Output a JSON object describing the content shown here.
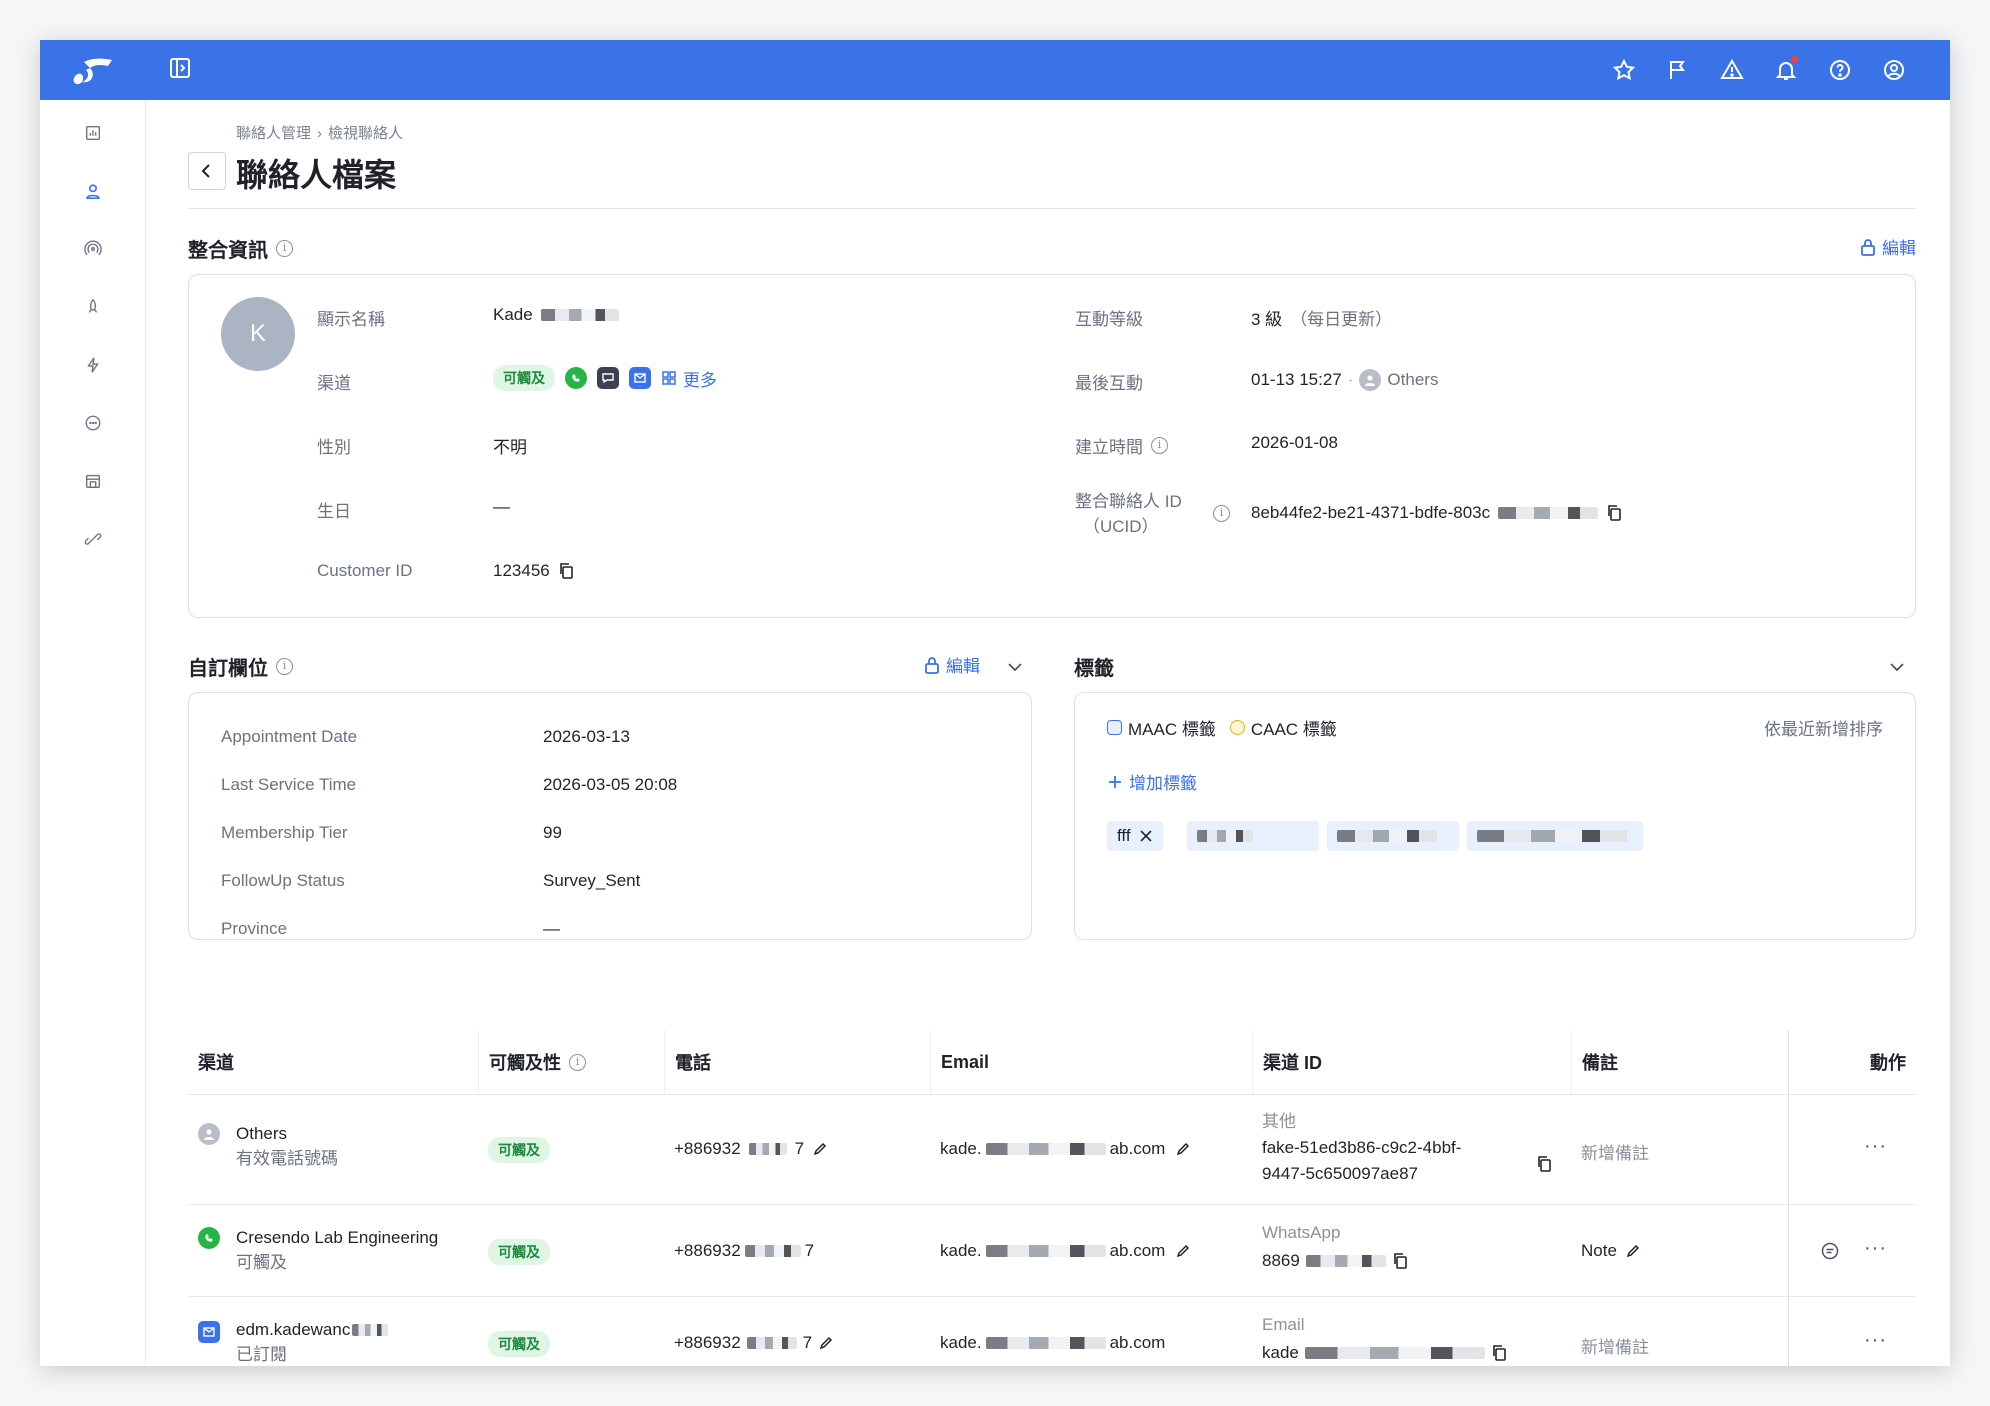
{
  "topbar": {
    "icons": [
      "star-icon",
      "flag-icon",
      "warning-icon",
      "bell-icon",
      "help-icon",
      "account-icon"
    ]
  },
  "sidebar": {
    "items": [
      "dashboard-icon",
      "contacts-icon",
      "broadcast-icon",
      "rocket-icon",
      "automation-icon",
      "chat-icon",
      "store-icon",
      "integration-icon"
    ]
  },
  "breadcrumb": {
    "parent": "聯絡人管理",
    "separator": "›",
    "current": "檢視聯絡人"
  },
  "page_title": "聯絡人檔案",
  "integrated": {
    "title": "整合資訊",
    "edit_label": "編輯",
    "avatar_letter": "K",
    "left": {
      "display_name_label": "顯示名稱",
      "display_name_value": "Kade",
      "channel_label": "渠道",
      "channel_badge": "可觸及",
      "channel_more": "更多",
      "gender_label": "性別",
      "gender_value": "不明",
      "birthday_label": "生日",
      "birthday_value": "—",
      "customer_id_label": "Customer ID",
      "customer_id_value": "123456"
    },
    "right": {
      "engagement_label": "互動等級",
      "engagement_value": "3 級",
      "engagement_note": "（每日更新）",
      "last_interaction_label": "最後互動",
      "last_interaction_value": "01-13 15:27",
      "last_interaction_dot": "·",
      "last_interaction_channel": "Others",
      "created_label": "建立時間",
      "created_value": "2026-01-08",
      "ucid_label": "整合聯絡人 ID",
      "ucid_label2": "（UCID）",
      "ucid_value": "8eb44fe2-be21-4371-bdfe-803c"
    }
  },
  "custom_fields": {
    "title": "自訂欄位",
    "edit_label": "編輯",
    "rows": [
      {
        "key": "Appointment Date",
        "value": "2026-03-13"
      },
      {
        "key": "Last Service Time",
        "value": "2026-03-05 20:08"
      },
      {
        "key": "Membership Tier",
        "value": "99"
      },
      {
        "key": "FollowUp Status",
        "value": "Survey_Sent"
      },
      {
        "key": "Province",
        "value": "—"
      }
    ]
  },
  "tags": {
    "title": "標籤",
    "maac_label": "MAAC 標籤",
    "caac_label": "CAAC 標籤",
    "sort_label": "依最近新增排序",
    "add_label": "增加標籤",
    "chips": [
      "fff"
    ]
  },
  "table": {
    "headers": {
      "channel": "渠道",
      "reach": "可觸及性",
      "phone": "電話",
      "email": "Email",
      "channel_id": "渠道 ID",
      "note": "備註",
      "action": "動作"
    },
    "rows": [
      {
        "name": "Others",
        "sub": "有效電話號碼",
        "badge": "可觸及",
        "phone_a": "+886932",
        "phone_b": "7",
        "email_a": "kade.",
        "email_b": "ab.com",
        "cid_type": "其他",
        "cid_value": "fake-51ed3b86-c9c2-4bbf-",
        "cid_value2": "9447-5c650097ae87",
        "note": "新增備註"
      },
      {
        "name": "Cresendo Lab Engineering",
        "sub": "可觸及",
        "badge": "可觸及",
        "phone_a": "+886932",
        "phone_b": "7",
        "email_a": "kade.",
        "email_b": "ab.com",
        "cid_type": "WhatsApp",
        "cid_value": "8869",
        "note": "Note"
      },
      {
        "name": "edm.kadewanc",
        "sub": "已訂閱",
        "badge": "可觸及",
        "phone_a": "+886932",
        "phone_b": "7",
        "email_a": "kade.",
        "email_b": "ab.com",
        "cid_type": "Email",
        "cid_value": "kade",
        "note": "新增備註"
      }
    ],
    "more_label": "···"
  },
  "colors": {
    "brand": "#3a72e8",
    "reach_green": "#1e8a3e",
    "whatsapp": "#25b546"
  }
}
